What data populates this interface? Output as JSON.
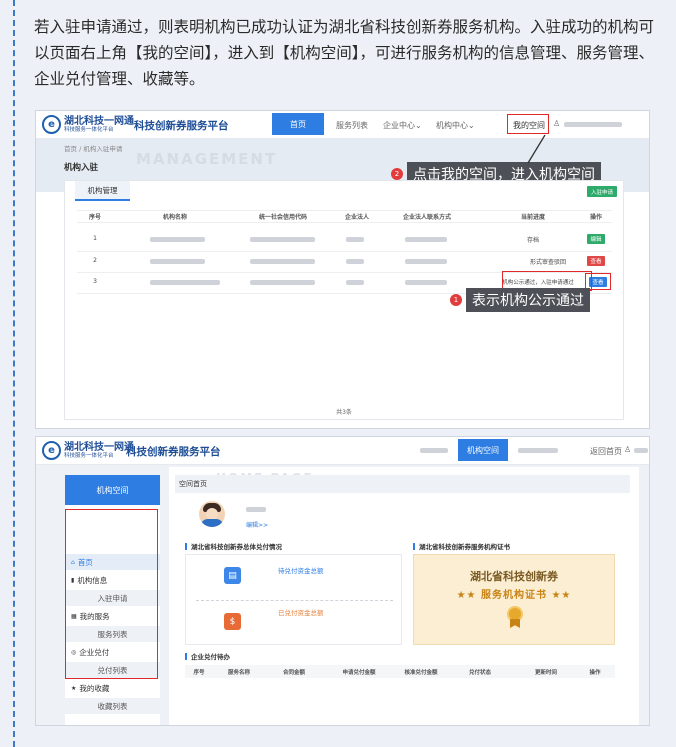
{
  "intro_text": "若入驻申请通过，则表明机构已成功认证为湖北省科技创新券服务机构。入驻成功的机构可以页面右上角【我的空间】，进入到【机构空间】，可进行服务机构的信息管理、服务管理、企业兑付管理、收藏等。",
  "header": {
    "logo_title": "湖北科技一网通",
    "logo_subtitle": "科技服务一体化平台",
    "platform_name": "科技创新券服务平台",
    "logo_mark": "e"
  },
  "screen1": {
    "nav": {
      "home": "首页",
      "service_list": "服务列表",
      "enterprise_center": "企业中心",
      "agency_center": "机构中心",
      "my_space": "我的空间"
    },
    "breadcrumb": "首页  /  机构入驻申请",
    "page_title": "机构入驻",
    "watermark": "MANAGEMENT",
    "tab": "机构管理",
    "apply_button": "入驻申请",
    "columns": [
      "序号",
      "机构名称",
      "统一社会信用代码",
      "企业法人",
      "企业法人联系方式",
      "当前进度",
      "操作"
    ],
    "rows": [
      {
        "no": "1",
        "status": "存档",
        "action": "编辑",
        "action_color": "#2eab6a"
      },
      {
        "no": "2",
        "status": "形式审查驳回",
        "action": "查看",
        "action_color": "#e04848"
      },
      {
        "no": "3",
        "status": "机构公示通过，入驻申请通过",
        "action": "查看",
        "action_color": "#2d7de2"
      }
    ],
    "total": "共3条",
    "callout_space": {
      "num": "2",
      "text": "点击我的空间，进入机构空间"
    },
    "callout_pass": {
      "num": "1",
      "text": "表示机构公示通过"
    }
  },
  "screen2": {
    "nav_active": "机构空间",
    "back_home": "返回首页",
    "sidebar_title": "机构空间",
    "sidebar": [
      {
        "label": "首页",
        "icon": "home-icon",
        "glyph": "⌂",
        "level": 0
      },
      {
        "label": "机构信息",
        "icon": "chart-icon",
        "glyph": "▮",
        "level": 0
      },
      {
        "label": "入驻申请",
        "level": 1
      },
      {
        "label": "我的服务",
        "icon": "grid-icon",
        "glyph": "▦",
        "level": 0
      },
      {
        "label": "服务列表",
        "level": 1
      },
      {
        "label": "企业兑付",
        "icon": "circle-icon",
        "glyph": "◎",
        "level": 0
      },
      {
        "label": "兑付列表",
        "level": 1
      },
      {
        "label": "我的收藏",
        "icon": "star-icon",
        "glyph": "★",
        "level": 0
      },
      {
        "label": "收藏列表",
        "level": 1
      }
    ],
    "home_title": "空间首页",
    "home_watermark": "HOME PAGE",
    "edit_link": "编辑>>",
    "payout_section": "湖北省科技创新券总体兑付情况",
    "pending_label": "待兑付资金总额",
    "paid_label": "已兑付资金总额",
    "cert_section": "湖北省科技创新券服务机构证书",
    "cert_title": "湖北省科技创新券",
    "cert_subtitle": "★★ 服务机构证书 ★★",
    "todo_section": "企业兑付待办",
    "todo_columns": [
      "序号",
      "服务名称",
      "合同金额",
      "申请兑付金额",
      "核准兑付金额",
      "兑付状态",
      "更新时间",
      "操作"
    ]
  }
}
